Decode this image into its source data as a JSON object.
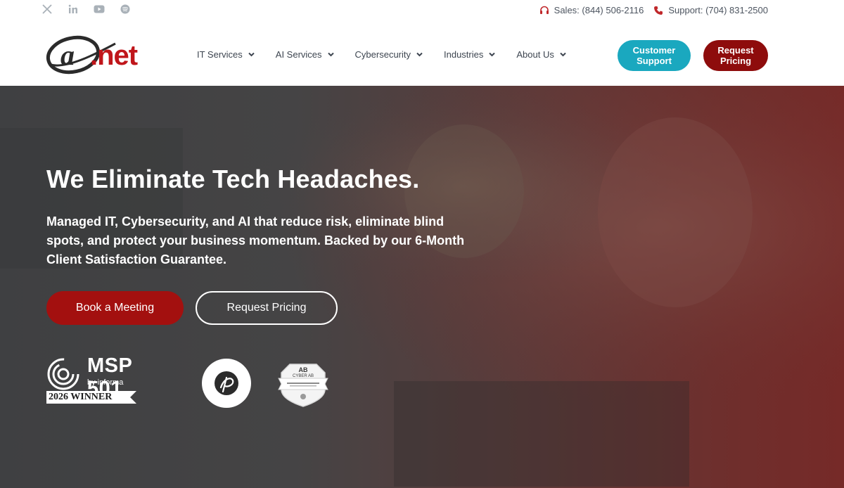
{
  "social": {
    "icons": [
      "x-icon",
      "linkedin-icon",
      "youtube-icon",
      "spotify-icon"
    ]
  },
  "contact": {
    "sales": "Sales: (844) 506-2116",
    "support": "Support: (704) 831-2500"
  },
  "header": {
    "logo_text": "@.net",
    "nav": [
      {
        "label": "IT Services"
      },
      {
        "label": "AI Services"
      },
      {
        "label": "Cybersecurity"
      },
      {
        "label": "Industries"
      },
      {
        "label": "About Us"
      }
    ],
    "support_button": {
      "line1": "Customer",
      "line2": "Support"
    },
    "pricing_button": {
      "line1": "Request",
      "line2": "Pricing"
    }
  },
  "hero": {
    "title": "We Eliminate Tech Headaches.",
    "lead": "Managed IT, Cybersecurity, and AI that reduce risk, eliminate blind spots, and protect your business momentum. Backed by our 6-Month Client Satisfaction Guarantee.",
    "book_button": "Book a Meeting",
    "pricing_button": "Request Pricing",
    "badges": {
      "msp_title": "MSP 501",
      "msp_by": "by informa",
      "msp_winner": "2026 WINNER",
      "shield_title": "CYBER AB"
    }
  },
  "colors": {
    "accent_red": "#a3100f",
    "dark_red": "#8e0c0c",
    "teal": "#1aa8bf",
    "icon_red": "#c0282b"
  }
}
